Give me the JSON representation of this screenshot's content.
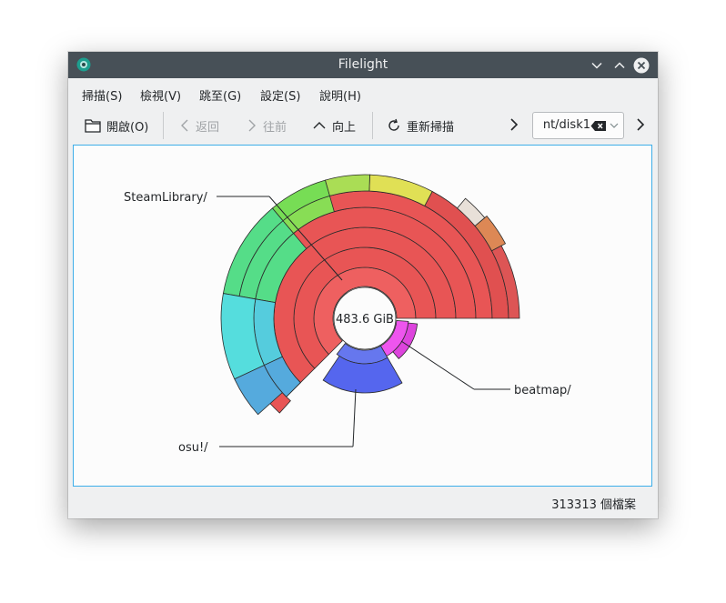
{
  "window": {
    "title": "Filelight",
    "colors": {
      "titlebar": "#475057",
      "accent": "#3daee9"
    }
  },
  "menu": [
    {
      "label": "掃描(S)"
    },
    {
      "label": "檢視(V)"
    },
    {
      "label": "跳至(G)"
    },
    {
      "label": "設定(S)"
    },
    {
      "label": "說明(H)"
    }
  ],
  "toolbar": {
    "open": {
      "label": "開啟(O)",
      "icon": "folder-icon"
    },
    "back": {
      "label": "返回",
      "icon": "chevron-left-icon",
      "enabled": false
    },
    "forward": {
      "label": "往前",
      "icon": "chevron-right-icon",
      "enabled": false
    },
    "up": {
      "label": "向上",
      "icon": "chevron-up-icon"
    },
    "rescan": {
      "label": "重新掃描",
      "icon": "refresh-icon"
    }
  },
  "location": {
    "value": "nt/disk1"
  },
  "chart": {
    "center_label": "483.6 GiB",
    "callouts": [
      {
        "label": "SteamLibrary/"
      },
      {
        "label": "beatmap/"
      },
      {
        "label": "osu!/"
      }
    ]
  },
  "status": {
    "file_count": "313313 個檔案"
  }
}
